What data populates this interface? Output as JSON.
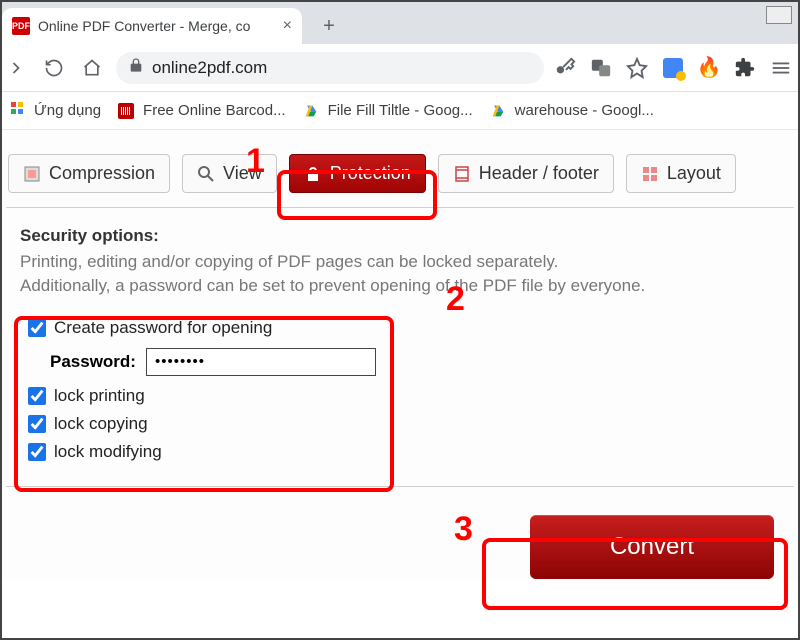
{
  "browser": {
    "tab_title": "Online PDF Converter - Merge, co",
    "favicon_text": "PDF",
    "url": "online2pdf.com"
  },
  "bookmarks": {
    "apps": "Ứng dụng",
    "barcode": "Free Online Barcod...",
    "filefill": "File Fill Tiltle - Goog...",
    "warehouse": "warehouse - Googl..."
  },
  "tabs": {
    "compression": "Compression",
    "view": "View",
    "protection": "Protection",
    "header_footer": "Header / footer",
    "layout": "Layout"
  },
  "security": {
    "heading": "Security options:",
    "desc1": "Printing, editing and/or copying of PDF pages can be locked separately.",
    "desc2": "Additionally, a password can be set to prevent opening of the PDF file by everyone.",
    "create_pw": "Create password for opening",
    "password_label": "Password:",
    "password_value": "••••••••",
    "lock_printing": "lock printing",
    "lock_copying": "lock copying",
    "lock_modifying": "lock modifying"
  },
  "convert_label": "Convert",
  "annotations": {
    "n1": "1",
    "n2": "2",
    "n3": "3"
  }
}
